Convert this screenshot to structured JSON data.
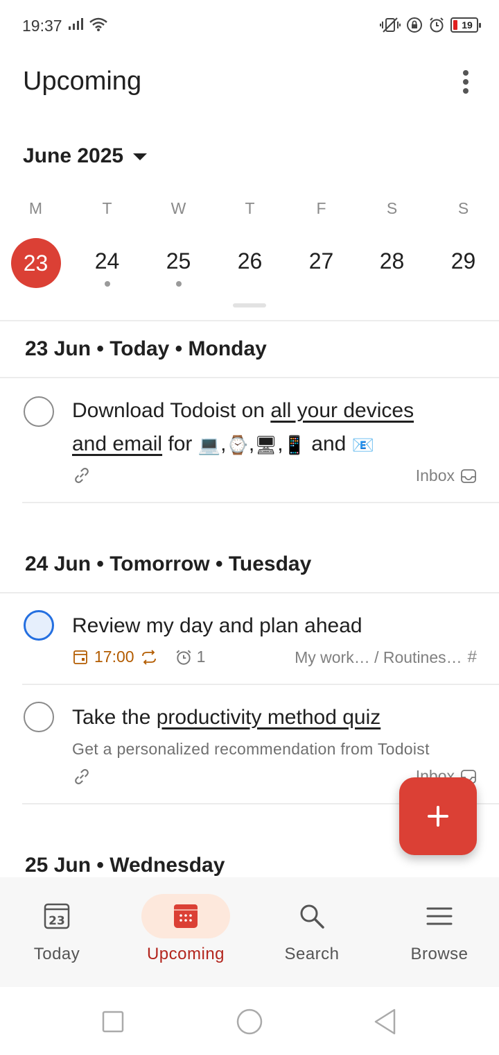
{
  "status_bar": {
    "time": "19:37",
    "battery": "19"
  },
  "header": {
    "title": "Upcoming",
    "month": "June 2025"
  },
  "week": [
    {
      "letter": "M",
      "num": "23",
      "selected": true,
      "has_tasks": false
    },
    {
      "letter": "T",
      "num": "24",
      "selected": false,
      "has_tasks": true
    },
    {
      "letter": "W",
      "num": "25",
      "selected": false,
      "has_tasks": true
    },
    {
      "letter": "T",
      "num": "26",
      "selected": false,
      "has_tasks": false
    },
    {
      "letter": "F",
      "num": "27",
      "selected": false,
      "has_tasks": false
    },
    {
      "letter": "S",
      "num": "28",
      "selected": false,
      "has_tasks": false
    },
    {
      "letter": "S",
      "num": "29",
      "selected": false,
      "has_tasks": false
    }
  ],
  "sections": {
    "today": "23 Jun • Today • Monday",
    "tomorrow": "24 Jun • Tomorrow • Tuesday",
    "wednesday": "25 Jun • Wednesday"
  },
  "tasks": {
    "download": {
      "text_prefix": "Download Todoist on ",
      "link_text_1": "all your devices",
      "link_text_2": "and email",
      "text_mid": " for ",
      "sep_1": ",",
      "sep_2": ",",
      "sep_3": ",",
      "text_and": " and ",
      "project": "Inbox"
    },
    "review": {
      "title": "Review my day and plan ahead",
      "time": "17:00",
      "reminders": "1",
      "project": "My work… / Routines…"
    },
    "quiz": {
      "text_prefix": "Take the ",
      "link_text": "productivity method quiz",
      "description": "Get a personalized recommendation from Todoist",
      "project": "Inbox"
    }
  },
  "nav": {
    "today": "Today",
    "upcoming": "Upcoming",
    "search": "Search",
    "browse": "Browse",
    "today_icon_num": "23"
  },
  "colors": {
    "accent": "#db4035",
    "blue": "#246fe0",
    "due_orange": "#b35c00"
  }
}
